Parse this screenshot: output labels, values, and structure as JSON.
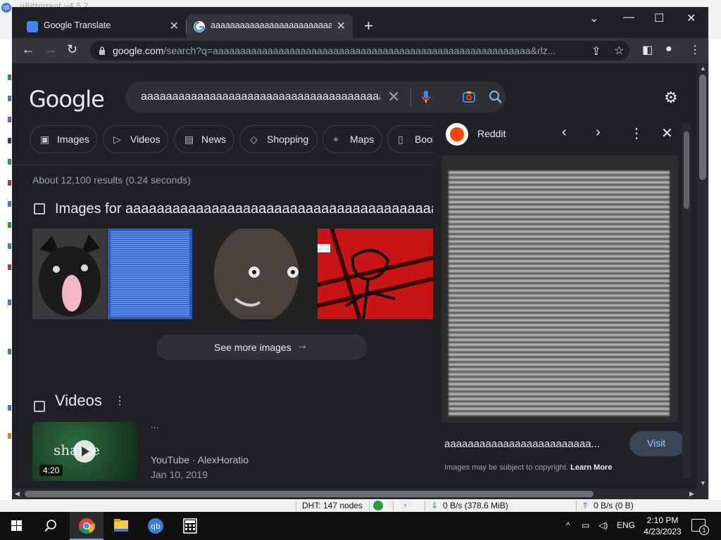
{
  "background_app": {
    "title": "qBittorrent v4.5.2",
    "status": {
      "dht": "DHT: 147 nodes",
      "download": "0 B/s (378.6 MiB)",
      "upload": "0 B/s (0 B)"
    }
  },
  "browser": {
    "tabs": [
      {
        "label": "Google Translate",
        "active": false
      },
      {
        "label": "aaaaaaaaaaaaaaaaaaaaaaaaaaaaaaaaaaaaaaaaaaaaaaaaaaaaaaa - Google Search",
        "active": true
      }
    ],
    "address": {
      "domain": "google.com",
      "path": "/search?q=aaaaaaaaaaaaaaaaaaaaaaaaaaaaaaaaaaaaaaaaaaaaaaaaaaaaaaaaaa&rlz..."
    }
  },
  "search": {
    "logo": "Google",
    "query": "aaaaaaaaaaaaaaaaaaaaaaaaaaaaaaaaaaaaaaaaaaaaa",
    "chips": [
      "Images",
      "Videos",
      "News",
      "Shopping",
      "Maps",
      "Books"
    ],
    "stats": "About 12,100 results (0.24 seconds)",
    "images_heading": "Images for aaaaaaaaaaaaaaaaaaaaaaaaaaaaaaaaaaaaaaaaaaaaaaa",
    "see_more": "See more images",
    "videos_heading": "Videos",
    "video": {
      "duration": "4:20",
      "thumb_word": "shame",
      "title": "...",
      "source": "YouTube · AlexHoratio",
      "date": "Jan 10, 2019"
    }
  },
  "side_panel": {
    "source": "Reddit",
    "caption": "aaaaaaaaaaaaaaaaaaaaaaaaa...",
    "visit_label": "Visit",
    "copyright_text": "Images may be subject to copyright.",
    "learn_more": "Learn More"
  },
  "taskbar": {
    "lang": "ENG",
    "time": "2:10 PM",
    "date": "4/23/2023",
    "notification_count": "1"
  },
  "colors": {
    "page_bg": "#202124",
    "chip_border": "#3c4043",
    "link_blue": "#8ab4f8",
    "reddit_orange": "#ff4500"
  }
}
